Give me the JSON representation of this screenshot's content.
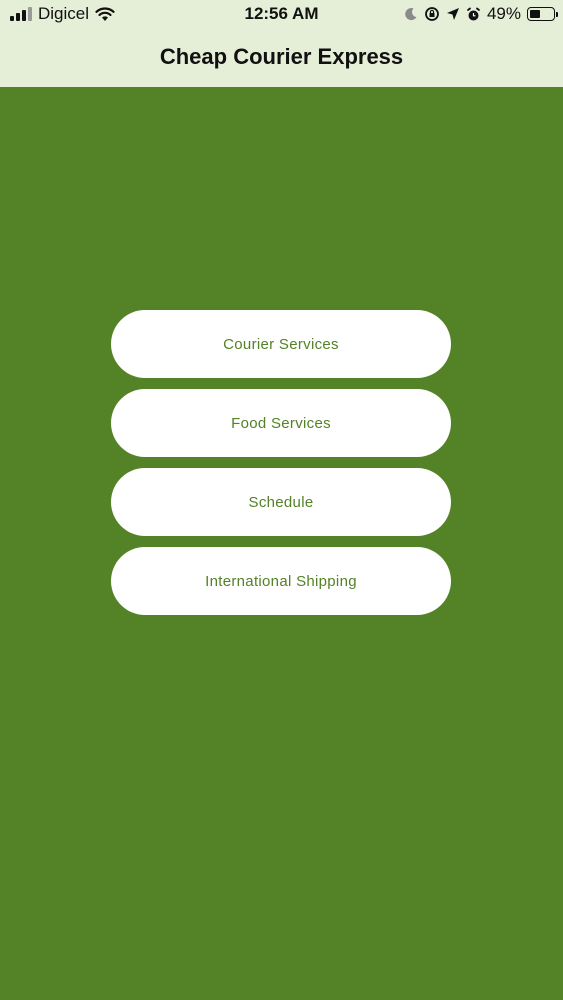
{
  "status_bar": {
    "carrier": "Digicel",
    "time": "12:56 AM",
    "battery_percent_text": "49%",
    "battery_level": 0.49,
    "signal_bars_filled": 3,
    "signal_bars_total": 4,
    "icons": [
      "signal-icon",
      "wifi-icon",
      "moon-icon",
      "rotation-lock-icon",
      "location-icon",
      "alarm-icon",
      "battery-icon"
    ]
  },
  "nav": {
    "title": "Cheap Courier Express"
  },
  "menu": {
    "items": [
      {
        "label": "Courier Services"
      },
      {
        "label": "Food Services"
      },
      {
        "label": "Schedule"
      },
      {
        "label": "International Shipping"
      }
    ]
  },
  "colors": {
    "background": "#548227",
    "header_background": "#e5eed6",
    "button_background": "#ffffff",
    "button_text": "#548227"
  }
}
